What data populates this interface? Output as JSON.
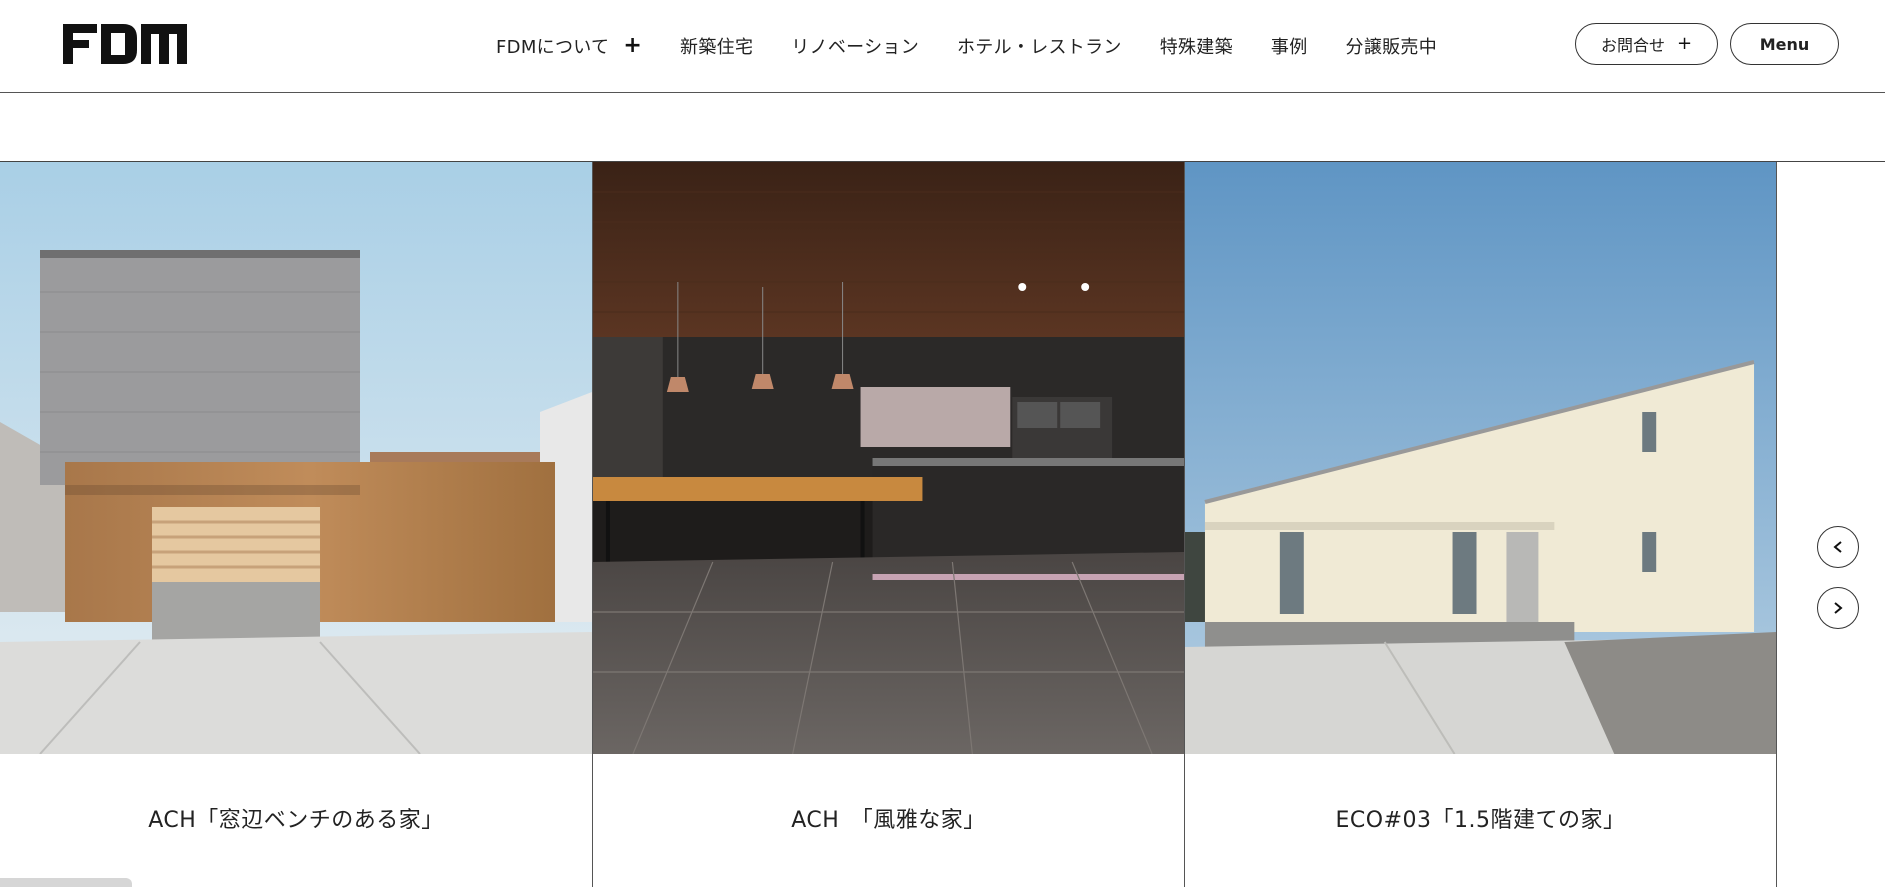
{
  "header": {
    "logo_text": "FDM",
    "nav": [
      {
        "label": "FDMについて",
        "has_plus": true
      },
      {
        "label": "新築住宅"
      },
      {
        "label": "リノベーション"
      },
      {
        "label": "ホテル・レストラン"
      },
      {
        "label": "特殊建築"
      },
      {
        "label": "事例"
      },
      {
        "label": "分譲販売中"
      }
    ],
    "contact_label": "お問合せ",
    "menu_label": "Menu"
  },
  "slider": {
    "cards": [
      {
        "caption": "ACH「窓辺ベンチのある家」",
        "image": "house-exterior-wood-box"
      },
      {
        "caption": "ACH　「風雅な家」",
        "image": "interior-kitchen-dark"
      },
      {
        "caption": "ECO#03「1.5階建ての家」",
        "image": "house-exterior-white-slope"
      }
    ],
    "prev_icon": "chevron-left-icon",
    "next_icon": "chevron-right-icon"
  },
  "colors": {
    "text": "#222222",
    "border": "#333333",
    "background": "#ffffff"
  }
}
